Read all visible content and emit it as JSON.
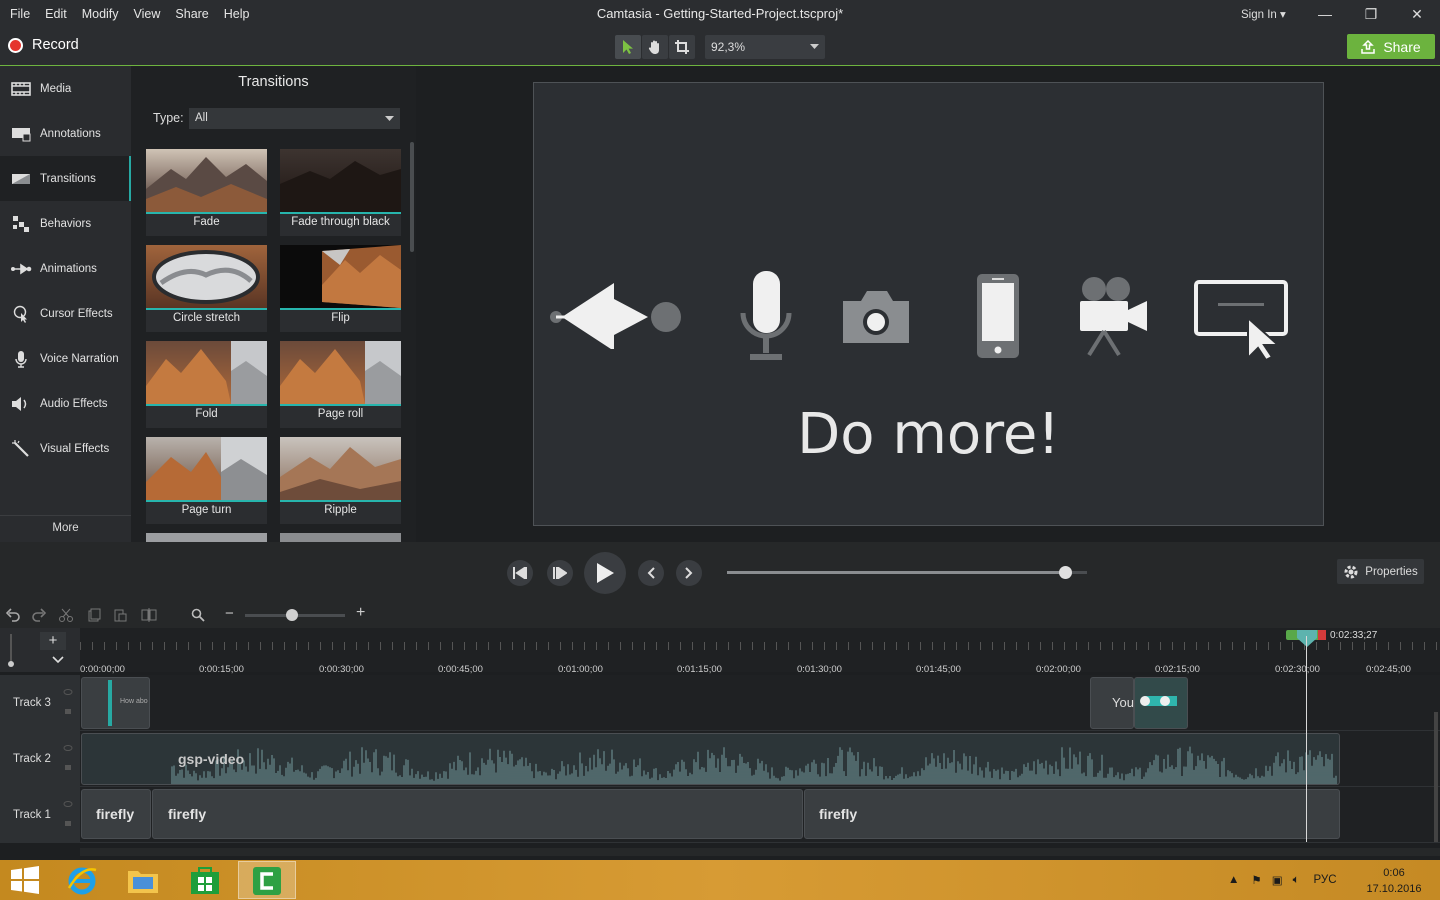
{
  "window": {
    "title": "Camtasia - Getting-Started-Project.tscproj*",
    "menus": [
      "File",
      "Edit",
      "Modify",
      "View",
      "Share",
      "Help"
    ],
    "sign_in": "Sign In ▾",
    "minimize": "—",
    "restore": "❐",
    "close": "✕"
  },
  "toolbar": {
    "record_label": "Record",
    "zoom_value": "92,3%",
    "share_label": "Share"
  },
  "sidebar": {
    "items": [
      {
        "label": "Media",
        "icon": "film-icon"
      },
      {
        "label": "Annotations",
        "icon": "annotation-icon"
      },
      {
        "label": "Transitions",
        "icon": "transition-icon"
      },
      {
        "label": "Behaviors",
        "icon": "behaviors-icon"
      },
      {
        "label": "Animations",
        "icon": "arrow-right-icon"
      },
      {
        "label": "Cursor Effects",
        "icon": "cursor-icon"
      },
      {
        "label": "Voice Narration",
        "icon": "microphone-icon"
      },
      {
        "label": "Audio Effects",
        "icon": "speaker-icon"
      },
      {
        "label": "Visual Effects",
        "icon": "magic-wand-icon"
      }
    ],
    "active": "Transitions",
    "more_label": "More"
  },
  "transitions": {
    "title": "Transitions",
    "type_label": "Type:",
    "type_value": "All",
    "items": [
      "Fade",
      "Fade through black",
      "Circle stretch",
      "Flip",
      "Fold",
      "Page roll",
      "Page turn",
      "Ripple"
    ]
  },
  "canvas": {
    "headline": "Do more!"
  },
  "playback": {
    "properties_label": "Properties",
    "scrub_fraction": 0.94
  },
  "timeline": {
    "playhead_time": "0:02:33;27",
    "ticks": [
      "0:00:00;00",
      "0:00:15;00",
      "0:00:30;00",
      "0:00:45;00",
      "0:01:00;00",
      "0:01:15;00",
      "0:01:30;00",
      "0:01:45;00",
      "0:02:00;00",
      "0:02:15;00",
      "0:02:30;00",
      "0:02:45;00"
    ],
    "tracks": [
      {
        "label": "Track 3",
        "clips": [
          "How abo",
          "You"
        ]
      },
      {
        "label": "Track 2",
        "clips": [
          "gsp-video"
        ]
      },
      {
        "label": "Track 1",
        "clips": [
          "firefly",
          "firefly",
          "firefly"
        ]
      }
    ]
  },
  "taskbar": {
    "language": "РУС",
    "time": "0:06",
    "date": "17.10.2016"
  },
  "colors": {
    "accent_green": "#6cb33e",
    "accent_teal": "#27b5ad",
    "record_red": "#e5342e"
  }
}
